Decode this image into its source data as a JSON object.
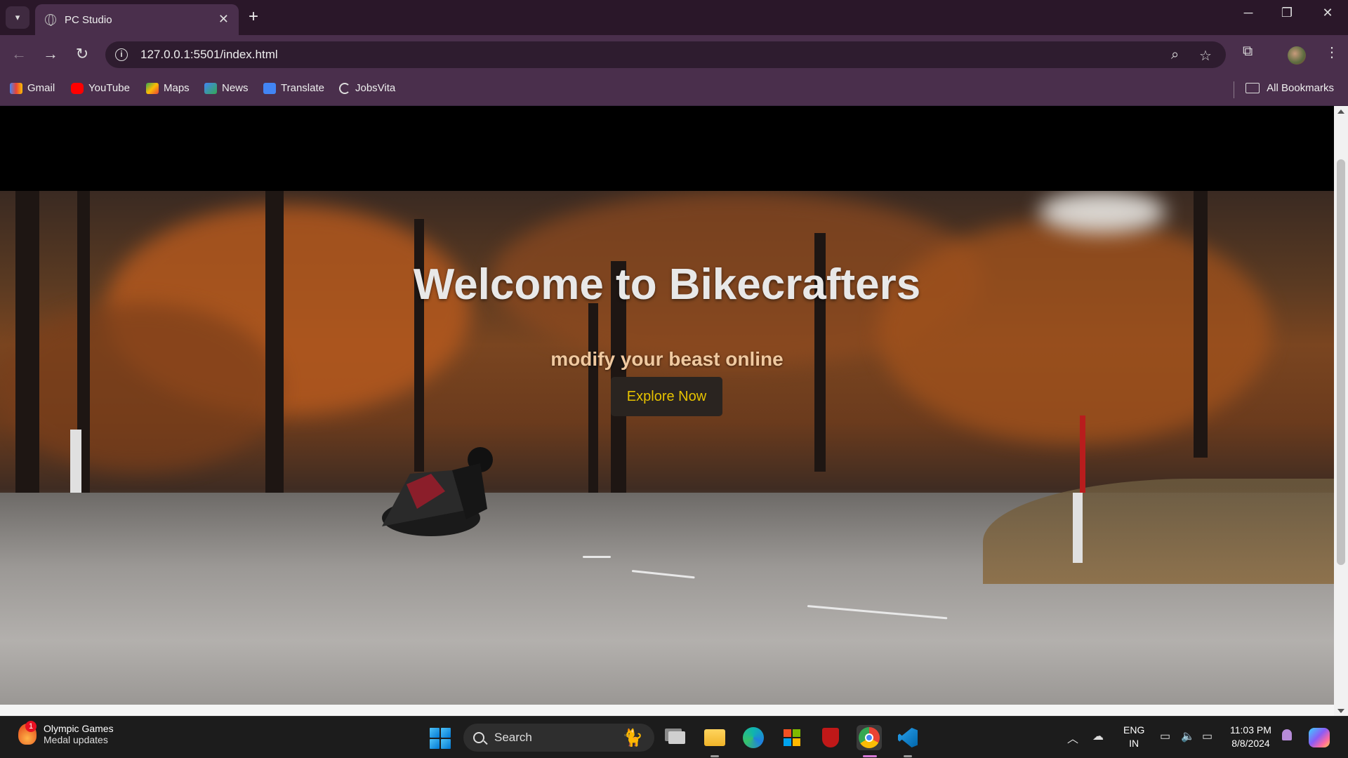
{
  "browser": {
    "tab_title": "PC Studio",
    "tab_close": "✕",
    "new_tab": "+",
    "url": "127.0.0.1:5501/index.html",
    "bookmarks": [
      {
        "label": "Gmail",
        "icon": "gmail-icon",
        "color": "#ea4335"
      },
      {
        "label": "YouTube",
        "icon": "youtube-icon",
        "color": "#ff0000"
      },
      {
        "label": "Maps",
        "icon": "maps-icon",
        "color": "#34a853"
      },
      {
        "label": "News",
        "icon": "news-icon",
        "color": "#4285f4"
      },
      {
        "label": "Translate",
        "icon": "translate-icon",
        "color": "#4285f4"
      },
      {
        "label": "JobsVita",
        "icon": "jobsvita-icon",
        "color": "#ffffff"
      }
    ],
    "all_bookmarks": "All Bookmarks"
  },
  "page": {
    "hero_title": "Welcome to Bikecrafters",
    "hero_subtitle": "modify your beast online",
    "cta_label": "Explore Now"
  },
  "taskbar": {
    "widget_title": "Olympic Games",
    "widget_subtitle": "Medal updates",
    "widget_badge": "1",
    "search_placeholder": "Search",
    "lang_line1": "ENG",
    "lang_line2": "IN",
    "time": "11:03 PM",
    "date": "8/8/2024"
  }
}
